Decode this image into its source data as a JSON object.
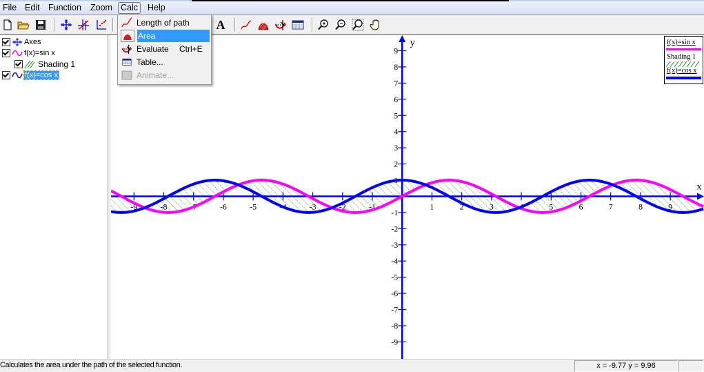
{
  "menubar": {
    "items": [
      "File",
      "Edit",
      "Function",
      "Zoom",
      "Calc",
      "Help"
    ],
    "open_item": "Calc"
  },
  "toolbar": {
    "buttons": [
      {
        "icon": "new-file-icon"
      },
      {
        "icon": "open-folder-icon"
      },
      {
        "icon": "save-disk-icon"
      },
      {
        "icon": "axes-icon"
      },
      {
        "icon": "insert-function-icon"
      },
      {
        "icon": "point-series-icon"
      },
      {
        "icon": "text-label-icon",
        "label": "A"
      },
      {
        "icon": "length-of-path-icon"
      },
      {
        "icon": "area-icon"
      },
      {
        "icon": "evaluate-icon"
      },
      {
        "icon": "table-icon"
      },
      {
        "icon": "zoom-in-icon"
      },
      {
        "icon": "zoom-out-icon"
      },
      {
        "icon": "zoom-window-icon"
      },
      {
        "icon": "pan-hand-icon"
      }
    ]
  },
  "calc_menu": {
    "items": [
      {
        "label": "Length of path",
        "shortcut": "",
        "icon": "length-of-path-icon",
        "highlighted": false,
        "disabled": false
      },
      {
        "label": "Area",
        "shortcut": "",
        "icon": "area-icon",
        "highlighted": true,
        "disabled": false
      },
      {
        "label": "Evaluate",
        "shortcut": "Ctrl+E",
        "icon": "evaluate-icon",
        "highlighted": false,
        "disabled": false
      },
      {
        "label": "Table...",
        "shortcut": "",
        "icon": "table-icon",
        "highlighted": false,
        "disabled": false
      },
      {
        "label": "Animate...",
        "shortcut": "",
        "icon": "animate-icon",
        "highlighted": false,
        "disabled": true
      }
    ]
  },
  "tree": {
    "items": [
      {
        "label": "Axes",
        "checked": true,
        "icon": "axes-icon",
        "level": 0,
        "selected": false
      },
      {
        "label": "f(x)=sin x",
        "checked": true,
        "icon": "sine-curve-icon",
        "level": 0,
        "selected": false,
        "color": "#ff00ff"
      },
      {
        "label": "Shading 1",
        "checked": true,
        "icon": "hatch-shading-icon",
        "level": 1,
        "selected": false
      },
      {
        "label": "f(x)=cos x",
        "checked": true,
        "icon": "sine-curve-icon",
        "level": 0,
        "selected": true,
        "color": "#0000ff"
      }
    ]
  },
  "legend": {
    "entries": [
      {
        "label": "f(x)=sin x",
        "color": "#ff00ff",
        "style": "line"
      },
      {
        "label": "Shading 1",
        "color": "#008000",
        "style": "hatch"
      },
      {
        "label": "f(x)=cos x",
        "color": "#0000ff",
        "style": "line"
      }
    ]
  },
  "graph": {
    "x_axis_label": "x",
    "y_axis_label": "y",
    "x_ticks": [
      -9,
      -8,
      -7,
      -6,
      -5,
      -4,
      -3,
      -2,
      -1,
      1,
      2,
      3,
      4,
      5,
      6,
      7,
      8,
      9
    ],
    "y_ticks": [
      9,
      8,
      7,
      6,
      5,
      4,
      3,
      2,
      1,
      -1,
      -2,
      -3,
      -4,
      -5,
      -6,
      -7,
      -8,
      -9
    ],
    "xlim": [
      -9.77,
      10.13
    ],
    "ylim": [
      -10.05,
      9.96
    ],
    "axis_color": "#0000ff",
    "functions": [
      {
        "name": "f(x)=sin x",
        "expr": "sin",
        "color": "#ff00ff"
      },
      {
        "name": "f(x)=cos x",
        "expr": "cos",
        "color": "#0000ff"
      }
    ],
    "shading": {
      "name": "Shading 1",
      "between": [
        "f(x)=sin x",
        "f(x)=cos x"
      ],
      "color": "#008000"
    }
  },
  "statusbar": {
    "message": "Calculates the area under the path of the selected function.",
    "coords": "x = -9.77   y = 9.96"
  }
}
